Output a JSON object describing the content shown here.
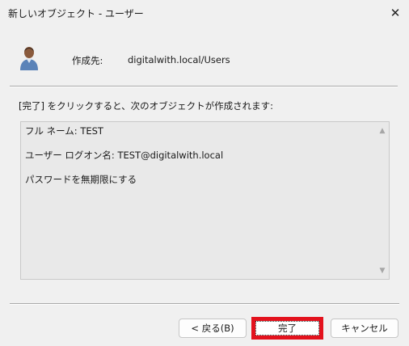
{
  "window": {
    "title": "新しいオブジェクト - ユーザー"
  },
  "header": {
    "create_in_label": "作成先:",
    "create_in_path": "digitalwith.local/Users"
  },
  "intro": "[完了] をクリックすると、次のオブジェクトが作成されます:",
  "summary": {
    "lines": [
      "フル ネーム: TEST",
      "ユーザー ログオン名: TEST@digitalwith.local",
      "パスワードを無期限にする"
    ]
  },
  "buttons": {
    "back": "< 戻る(B)",
    "finish": "完了",
    "cancel": "キャンセル"
  },
  "colors": {
    "highlight": "#e3121d",
    "background": "#f0f0f0"
  },
  "icons": {
    "close": "close-icon",
    "user": "user-icon"
  }
}
